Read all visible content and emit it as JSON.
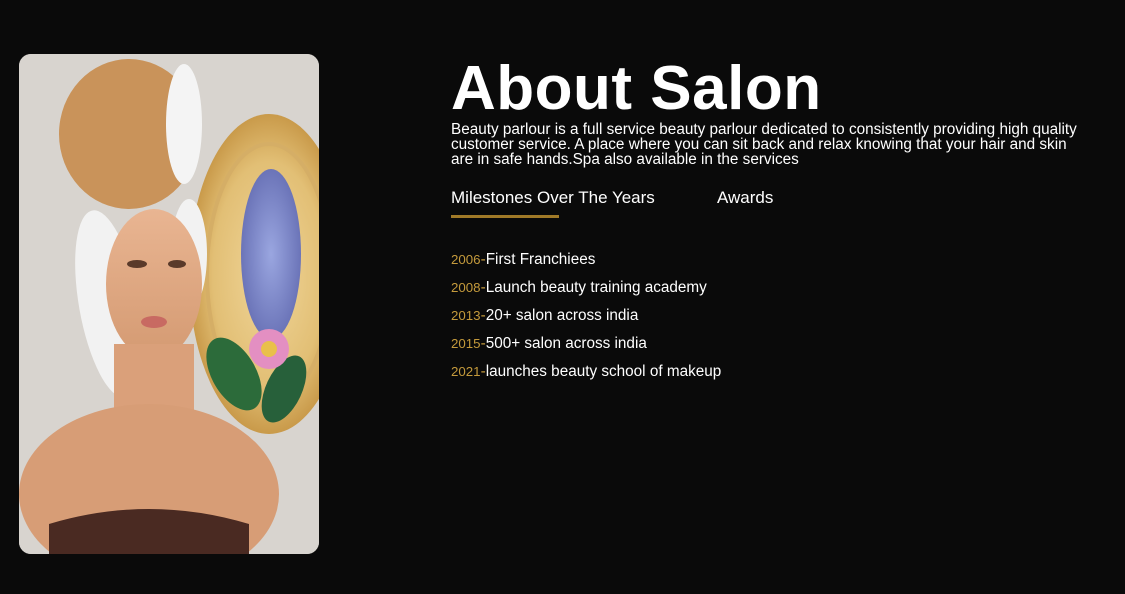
{
  "about": {
    "title": "About Salon",
    "description": "Beauty parlour is a full service beauty parlour dedicated to consistently providing high quality customer service. A place where you can sit back and relax knowing that your hair and skin are in safe hands.Spa also available in the services"
  },
  "tabs": [
    {
      "label": "Milestones Over The Years",
      "active": true
    },
    {
      "label": "Awards",
      "active": false
    }
  ],
  "milestones": [
    {
      "year": "2006",
      "sep": "-",
      "text": "First Franchiees"
    },
    {
      "year": "2008",
      "sep": "-",
      "text": "Launch beauty training academy"
    },
    {
      "year": "2013",
      "sep": "-",
      "text": "20+ salon across india"
    },
    {
      "year": "2015",
      "sep": "-",
      "text": "500+ salon across india"
    },
    {
      "year": "2021",
      "sep": "-",
      "text": "launches beauty school of makeup"
    }
  ],
  "colors": {
    "background": "#0a0a0a",
    "text": "#ffffff",
    "accent": "#c49a3c",
    "underline": "#a07a28"
  }
}
